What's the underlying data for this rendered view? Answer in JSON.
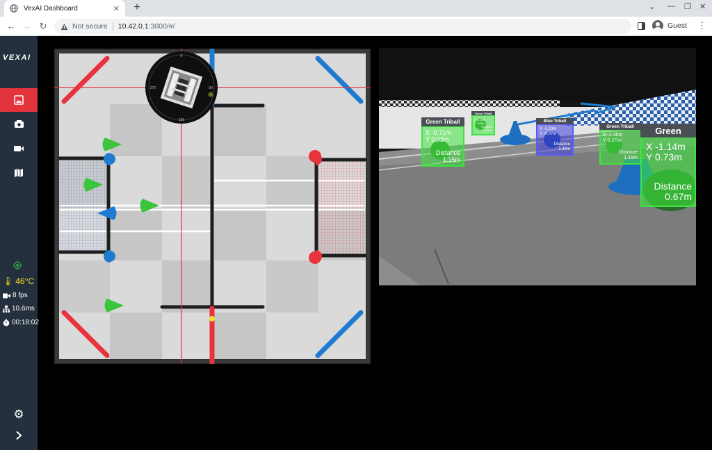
{
  "browser": {
    "tab_title": "VexAI Dashboard",
    "tab_close": "✕",
    "new_tab": "+",
    "not_secure": "Not secure",
    "url_host": "10.42.0.1",
    "url_path": ":3000/#/",
    "profile": "Guest"
  },
  "app": {
    "logo": "VEXAI",
    "nav": [
      {
        "name": "field-view",
        "icon": "image-icon",
        "active": true
      },
      {
        "name": "camera",
        "icon": "camera-icon",
        "active": false
      },
      {
        "name": "video",
        "icon": "video-icon",
        "active": false
      },
      {
        "name": "map",
        "icon": "map-icon",
        "active": false
      }
    ],
    "stats": {
      "temperature": "46°C",
      "fps": "8 fps",
      "latency": "10.6ms",
      "uptime": "00:18:02"
    },
    "accent_color": "#e3343e",
    "sidebar_color": "#25303e"
  },
  "field_view": {
    "compass": {
      "n": "0",
      "e": "90",
      "s": "180",
      "w": "270"
    }
  },
  "camera_view": {
    "detections": [
      {
        "label": "Green Triball",
        "x": "X -0.71m",
        "y": "Y 0.03m",
        "distance_label": "Distance",
        "distance": "1.15m",
        "color": "green"
      },
      {
        "label": "Green Triball",
        "x": "X -1.64m",
        "y": "Y 0.08m",
        "distance_label": "Distance",
        "distance": "2.46m",
        "color": "green"
      },
      {
        "label": "Blue Triball",
        "x": "X -1.23m",
        "y": "Y -0.07m",
        "distance_label": "Distance",
        "distance": "1.46m",
        "color": "blue"
      },
      {
        "label": "Green Triball",
        "x": "X -1.35m",
        "y": "Y 0.27m",
        "distance_label": "Distance",
        "distance": "1.19m",
        "color": "green"
      },
      {
        "label": "Green",
        "x": "X -1.14m",
        "y": "Y 0.73m",
        "distance_label": "Distance",
        "distance": "0.67m",
        "color": "green"
      }
    ]
  }
}
